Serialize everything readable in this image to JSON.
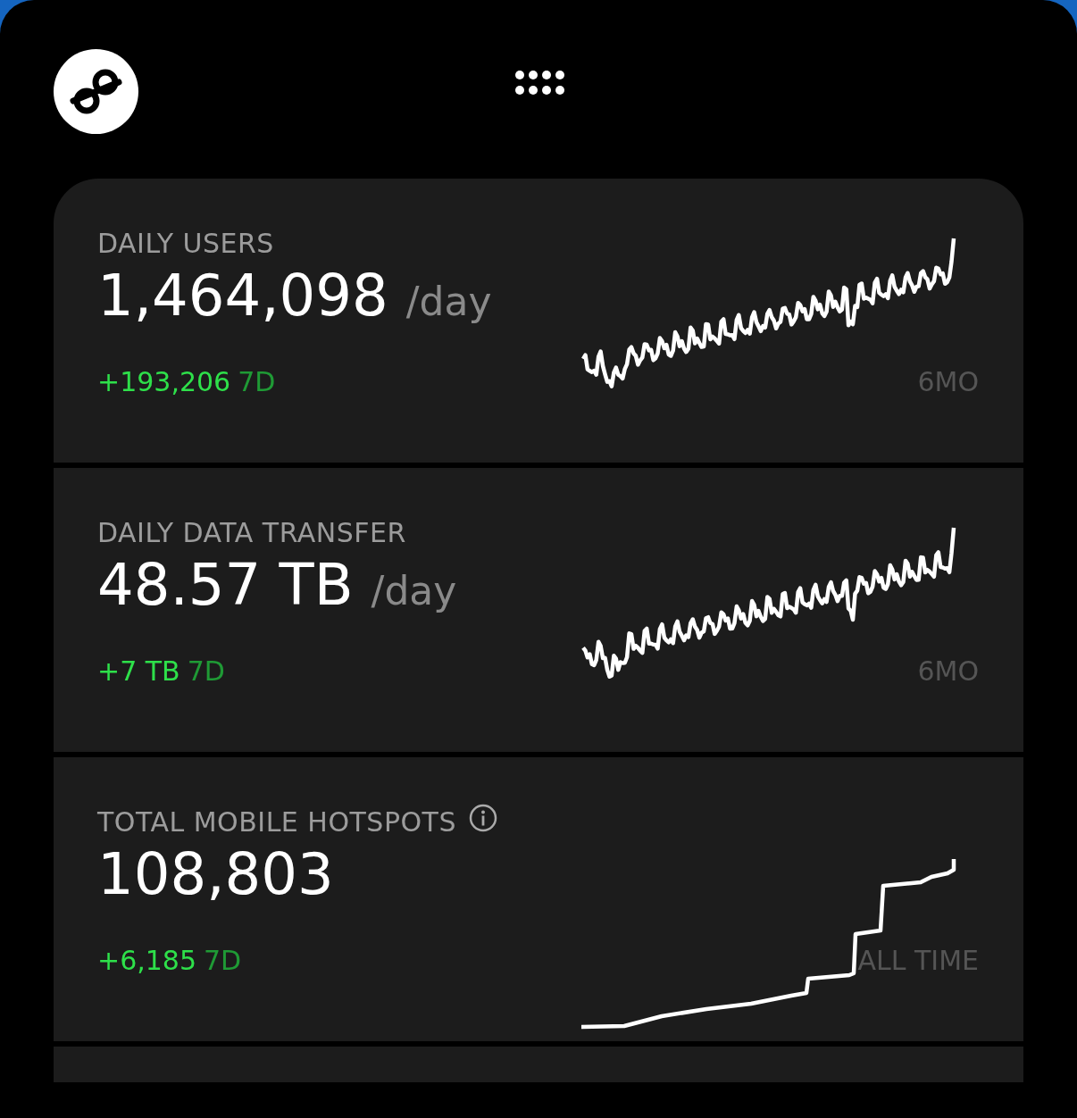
{
  "cards": [
    {
      "label": "DAILY USERS",
      "value": "1,464,098",
      "unit": "/day",
      "change": "+193,206",
      "change_period": "7D",
      "range": "6MO",
      "info": false
    },
    {
      "label": "DAILY DATA TRANSFER",
      "value": "48.57 TB",
      "unit": "/day",
      "change": "+7 TB",
      "change_period": "7D",
      "range": "6MO",
      "info": false
    },
    {
      "label": "TOTAL MOBILE HOTSPOTS",
      "value": "108,803",
      "change": "+6,185",
      "change_period": "7D",
      "range": "ALL TIME",
      "info": true
    }
  ]
}
